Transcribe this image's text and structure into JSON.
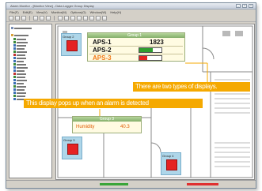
{
  "window": {
    "title": "Alarm Monitor - [Monitor View] - Data Logger Group Display",
    "controls": [
      "_",
      "□",
      "×"
    ]
  },
  "menu": [
    "File(F)",
    "Edit(E)",
    "View(V)",
    "Monitor(M)",
    "Options(O)",
    "Window(W)",
    "Help(H)"
  ],
  "floor_plan": {
    "groups": [
      {
        "label": "Group 2"
      },
      {
        "label": "Group 3"
      },
      {
        "label": "Group 4"
      }
    ],
    "group1_panel": {
      "title": "Group 1",
      "rows": [
        {
          "label": "APS-1",
          "value": "1823",
          "label_color": "#111111"
        },
        {
          "label": "APS-2",
          "level": 0.6,
          "bar_color": "#2f9e2f",
          "label_color": "#111111"
        },
        {
          "label": "APS-3",
          "level": 0.35,
          "bar_color": "#e52222",
          "label_color": "#f07a1a"
        }
      ]
    },
    "group3_panel": {
      "title": "Group 3",
      "row": {
        "label": "Humidity",
        "value": "40.3"
      }
    }
  },
  "callouts": {
    "two_types": "There are two types of displays.",
    "popup": "This display pops up when an alarm is detected"
  },
  "colors": {
    "callout": "#f5a900",
    "alarm": "#e52222",
    "group_box": "#aed6e9",
    "panel_header": "#9cc482"
  },
  "statusbar": {
    "indicators": [
      "green",
      "red"
    ]
  }
}
